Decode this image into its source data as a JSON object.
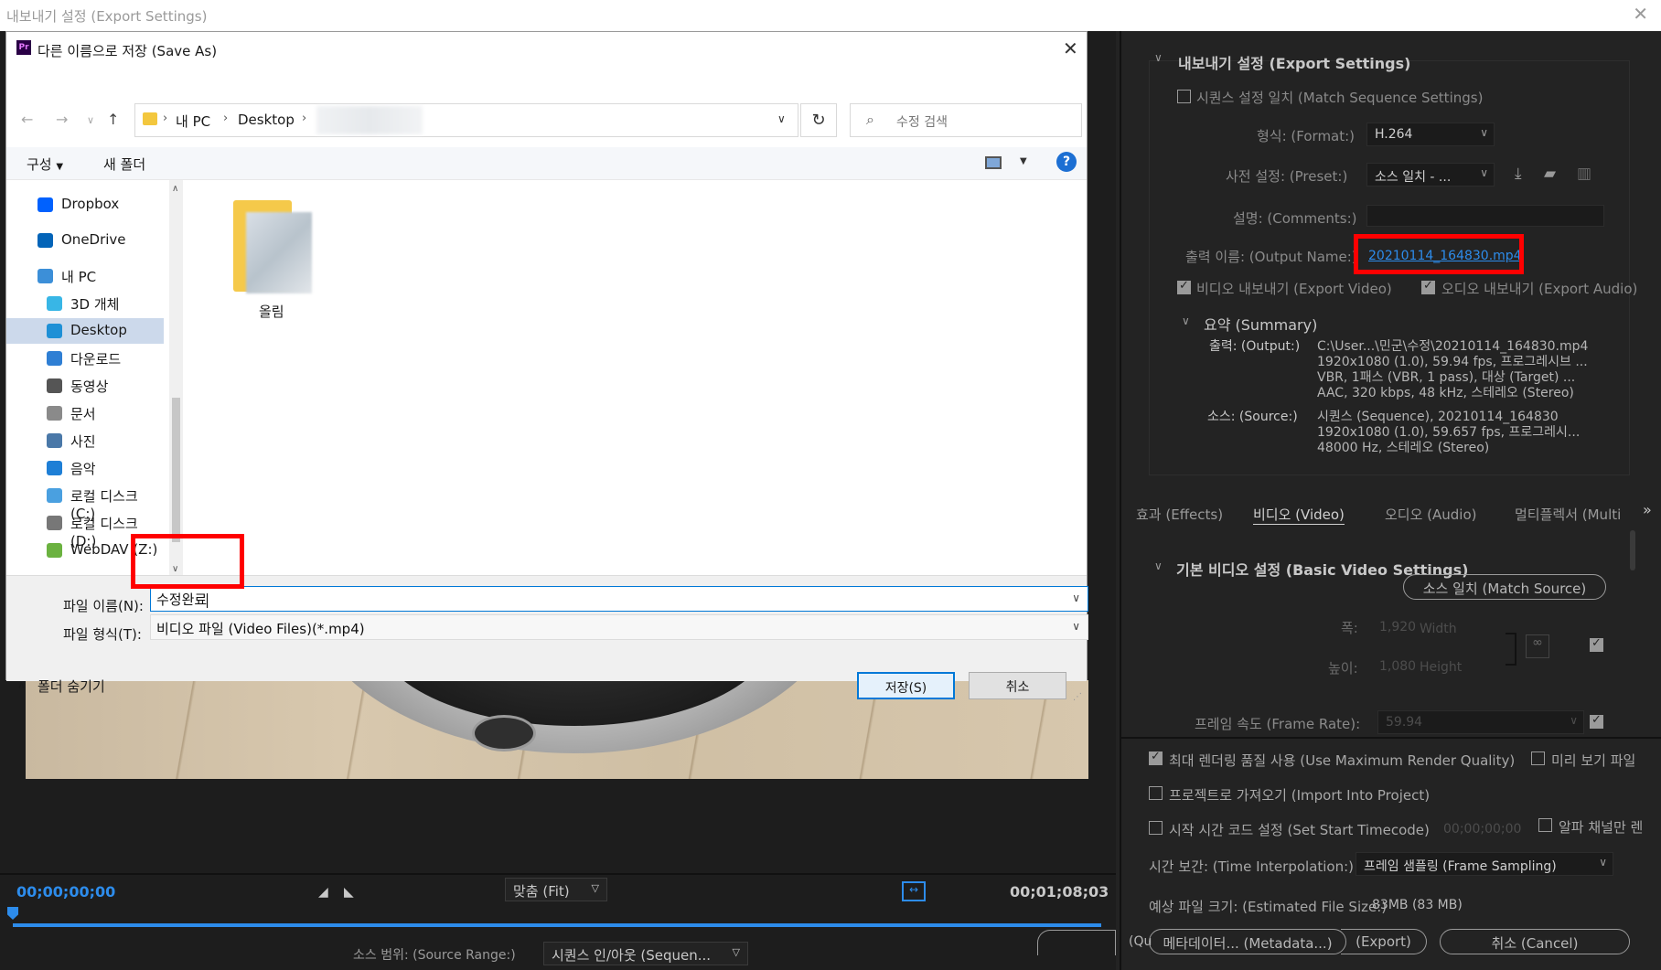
{
  "window": {
    "title": "내보내기 설정 (Export Settings)",
    "close_icon": "✕"
  },
  "player": {
    "timecode_start": "00;00;00;00",
    "timecode_end": "00;01;08;03",
    "fit": "맞춤 (Fit)",
    "source_range_label": "소스 범위: (Source Range:)",
    "source_range_value": "시퀀스 인/아웃 (Sequen..."
  },
  "export_settings": {
    "section_title": "내보내기 설정 (Export Settings)",
    "match_sequence": "시퀀스 설정 일치 (Match Sequence Settings)",
    "format_label": "형식: (Format:)",
    "format_value": "H.264",
    "preset_label": "사전 설정: (Preset:)",
    "preset_value": "소스 일치 - ...",
    "comments_label": "설명: (Comments:)",
    "output_name_label": "출력 이름: (Output Name:)",
    "output_name_value": "20210114_164830.mp4",
    "export_video": "비디오 내보내기 (Export Video)",
    "export_audio": "오디오 내보내기 (Export Audio)",
    "summary_title": "요약 (Summary)",
    "output_label": "출력: (Output:)",
    "output_lines": [
      "C:\\User...\\민군\\수정\\20210114_164830.mp4",
      "1920x1080 (1.0), 59.94 fps, 프로그레시브 ...",
      "VBR, 1패스 (VBR, 1 pass), 대상 (Target) ...",
      "AAC, 320 kbps, 48 kHz, 스테레오 (Stereo)"
    ],
    "source_label": "소스: (Source:)",
    "source_lines": [
      "시퀀스 (Sequence), 20210114_164830",
      "1920x1080 (1.0), 59.657 fps, 프로그레시...",
      "48000 Hz, 스테레오 (Stereo)"
    ]
  },
  "tabs": [
    "효과 (Effects)",
    "비디오 (Video)",
    "오디오 (Audio)",
    "멀티플렉서 (Multi"
  ],
  "tabs_overflow": "»",
  "video": {
    "basic_title": "기본 비디오 설정 (Basic Video Settings)",
    "match_source_btn": "소스 일치 (Match Source)",
    "width_label": "폭:",
    "width_value": "1,920",
    "width_unit": "Width",
    "height_label": "높이:",
    "height_value": "1,080",
    "height_unit": "Height",
    "frame_rate_label": "프레임 속도 (Frame Rate):",
    "frame_rate_value": "59.94"
  },
  "bottom_options": {
    "max_render": "최대 렌더링 품질 사용 (Use Maximum Render Quality)",
    "preview": "미리 보기 파일",
    "import_project": "프로젝트로 가져오기 (Import Into Project)",
    "start_timecode": "시작 시간 코드 설정 (Set Start Timecode)",
    "start_timecode_value": "00;00;00;00",
    "alpha_only": "알파 채널만 렌",
    "time_interp_label": "시간 보간: (Time Interpolation:)",
    "time_interp_value": "프레임 샘플링 (Frame Sampling)",
    "est_size_label": "예상 파일 크기: (Estimated File Size:)",
    "est_size_value": "83MB (83 MB)",
    "queue_partial": "(Qu",
    "metadata_btn": "메타데이터... (Metadata...)",
    "export_btn": "(Export)",
    "cancel_btn": "취소 (Cancel)"
  },
  "save_dialog": {
    "title": "다른 이름으로 저장 (Save As)",
    "app_icon": "Pr",
    "breadcrumb": [
      "내 PC",
      "Desktop"
    ],
    "search_placeholder": "수정 검색",
    "organize": "구성",
    "new_folder": "새 폴더",
    "help": "?",
    "nav_items": [
      {
        "label": "Dropbox",
        "icon": "dropbox-icon",
        "color": "#0061fe"
      },
      {
        "label": "OneDrive",
        "icon": "onedrive-icon",
        "color": "#0364b8"
      },
      {
        "label": "내 PC",
        "icon": "pc-icon",
        "color": "#3c8fd8"
      },
      {
        "label": "3D 개체",
        "icon": "3d-objects-icon",
        "color": "#38b6e6"
      },
      {
        "label": "Desktop",
        "icon": "desktop-icon",
        "color": "#1e90d6"
      },
      {
        "label": "다운로드",
        "icon": "downloads-icon",
        "color": "#2f7fd4"
      },
      {
        "label": "동영상",
        "icon": "videos-icon",
        "color": "#555555"
      },
      {
        "label": "문서",
        "icon": "documents-icon",
        "color": "#8a8a8a"
      },
      {
        "label": "사진",
        "icon": "pictures-icon",
        "color": "#4a78a8"
      },
      {
        "label": "음악",
        "icon": "music-icon",
        "color": "#1e7fd6"
      },
      {
        "label": "로컬 디스크 (C:)",
        "icon": "drive-c-icon",
        "color": "#4aa0e0"
      },
      {
        "label": "로컬 디스크 (D:)",
        "icon": "drive-d-icon",
        "color": "#777777"
      },
      {
        "label": "WebDAV (Z:)",
        "icon": "network-drive-icon",
        "color": "#6bb240"
      }
    ],
    "folder_name": "올림",
    "filename_label": "파일 이름(N):",
    "filename_value": "수정완료",
    "filetype_label": "파일 형식(T):",
    "filetype_value": "비디오 파일 (Video Files)(*.mp4)",
    "hide_folders": "폴더 숨기기",
    "save_btn": "저장(S)",
    "cancel_btn": "취소"
  },
  "colors": {
    "accent_blue": "#2d8ceb",
    "highlight_red": "#ff0000",
    "dialog_primary": "#0078d7"
  }
}
